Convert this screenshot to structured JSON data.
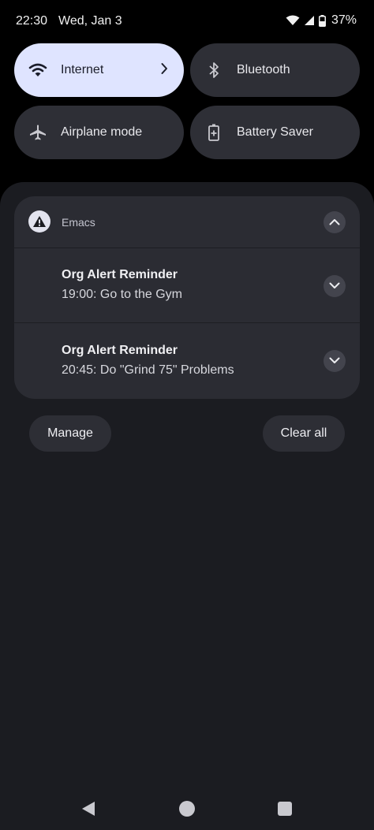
{
  "status_bar": {
    "time": "22:30",
    "date": "Wed, Jan 3",
    "battery_percent": "37%",
    "icons": [
      "wifi-icon",
      "cellular-signal-icon",
      "battery-icon"
    ]
  },
  "quick_settings": {
    "tiles": [
      {
        "label": "Internet",
        "icon": "wifi-icon",
        "active": true
      },
      {
        "label": "Bluetooth",
        "icon": "bluetooth-icon",
        "active": false
      },
      {
        "label": "Airplane mode",
        "icon": "airplane-icon",
        "active": false
      },
      {
        "label": "Battery Saver",
        "icon": "battery-saver-icon",
        "active": false
      }
    ]
  },
  "notification_group": {
    "app_name": "Emacs",
    "app_icon": "warning-icon",
    "notifications": [
      {
        "title": "Org Alert Reminder",
        "body": "19:00: Go to the Gym"
      },
      {
        "title": "Org Alert Reminder",
        "body": "20:45: Do \"Grind 75\" Problems"
      }
    ]
  },
  "actions": {
    "manage_label": "Manage",
    "clear_all_label": "Clear all"
  },
  "navigation": [
    "back-icon",
    "home-icon",
    "recents-icon"
  ],
  "colors": {
    "background": "#000000",
    "shade": "#1b1c21",
    "card": "#2b2c33",
    "active_tile": "#dfe4ff"
  }
}
